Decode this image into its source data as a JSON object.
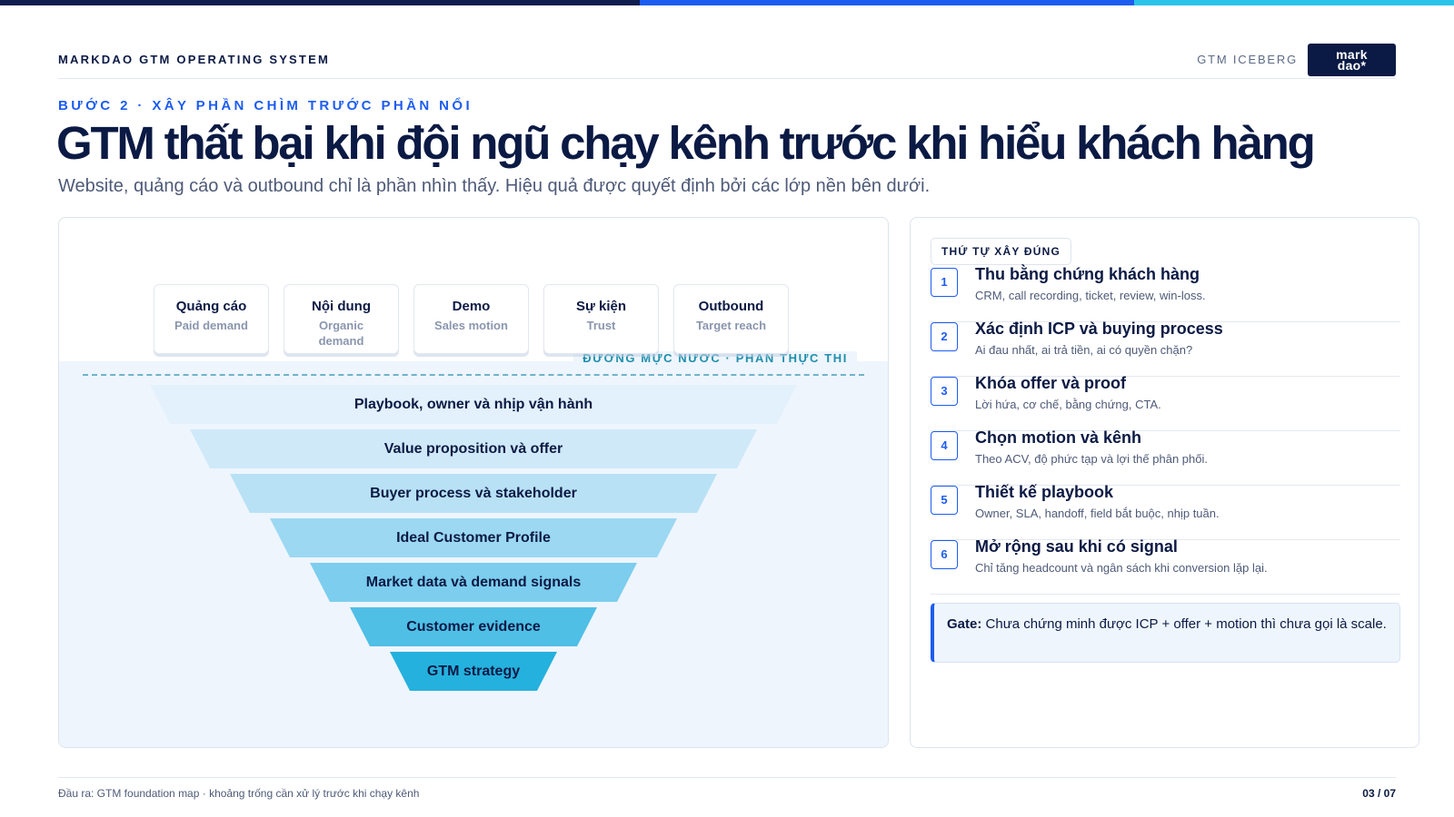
{
  "header": {
    "brand": "MARKDAO GTM OPERATING SYSTEM",
    "section": "GTM ICEBERG",
    "logo_line1": "mark",
    "logo_line2": "dao*"
  },
  "hero": {
    "eyebrow": "BƯỚC 2 · XÂY PHẦN CHÌM TRƯỚC PHẦN NỔI",
    "title": "GTM thất bại khi đội ngũ chạy kênh trước khi hiểu khách hàng",
    "subtitle": "Website, quảng cáo và outbound chỉ là phần nhìn thấy. Hiệu quả được quyết định bởi các lớp nền bên dưới."
  },
  "iceberg": {
    "channels": [
      {
        "title": "Quảng cáo",
        "sub": "Paid demand"
      },
      {
        "title": "Nội dung",
        "sub": "Organic demand"
      },
      {
        "title": "Demo",
        "sub": "Sales motion"
      },
      {
        "title": "Sự kiện",
        "sub": "Trust"
      },
      {
        "title": "Outbound",
        "sub": "Target reach"
      }
    ],
    "waterline_label": "ĐƯỜNG MỰC NƯỚC · PHẦN THỰC THI",
    "layers": [
      {
        "label": "Playbook, owner và nhịp vận hành",
        "color": "#e3f1fc"
      },
      {
        "label": "Value proposition và offer",
        "color": "#cfe9f9"
      },
      {
        "label": "Buyer process và stakeholder",
        "color": "#b8e1f6"
      },
      {
        "label": "Ideal Customer Profile",
        "color": "#9cd8f2"
      },
      {
        "label": "Market data và demand signals",
        "color": "#7ccdee"
      },
      {
        "label": "Customer evidence",
        "color": "#4fbfe6"
      },
      {
        "label": "GTM strategy",
        "color": "#25b1dd"
      }
    ]
  },
  "order": {
    "label": "THỨ TỰ XÂY ĐÚNG",
    "steps": [
      {
        "num": "1",
        "title": "Thu bằng chứng khách hàng",
        "desc": "CRM, call recording, ticket, review, win-loss."
      },
      {
        "num": "2",
        "title": "Xác định ICP và buying process",
        "desc": "Ai đau nhất, ai trả tiền, ai có quyền chặn?"
      },
      {
        "num": "3",
        "title": "Khóa offer và proof",
        "desc": "Lời hứa, cơ chế, bằng chứng, CTA."
      },
      {
        "num": "4",
        "title": "Chọn motion và kênh",
        "desc": "Theo ACV, độ phức tạp và lợi thế phân phối."
      },
      {
        "num": "5",
        "title": "Thiết kế playbook",
        "desc": "Owner, SLA, handoff, field bắt buộc, nhịp tuần."
      },
      {
        "num": "6",
        "title": "Mở rộng sau khi có signal",
        "desc": "Chỉ tăng headcount và ngân sách khi conversion lặp lại."
      }
    ],
    "gate_label": "Gate:",
    "gate_text": "Chưa chứng minh được ICP + offer + motion thì chưa gọi là scale."
  },
  "footer": {
    "note": "Đầu ra: GTM foundation map · khoảng trống cần xử lý trước khi chạy kênh",
    "page": "03 / 07"
  },
  "colors": {
    "navy": "#0b1a44",
    "accent_blue": "#1d5cf0",
    "accent_cyan": "#29c3ea",
    "water": "#eef5fd"
  }
}
